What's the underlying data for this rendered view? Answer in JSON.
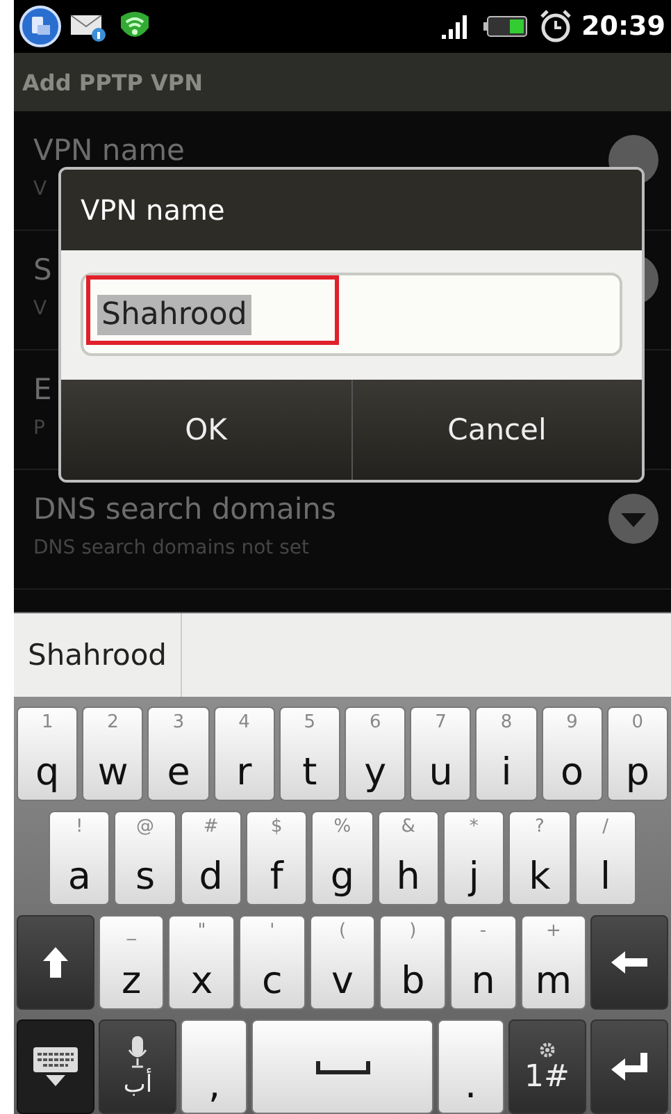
{
  "status_bar": {
    "time": "20:39"
  },
  "title_bar": {
    "title": "Add PPTP VPN"
  },
  "settings": [
    {
      "title": "VPN name",
      "summary": "V",
      "kind": "circle"
    },
    {
      "title": "S",
      "summary": "V",
      "kind": "circle"
    },
    {
      "title": "E",
      "summary": "P",
      "kind": "none"
    },
    {
      "title": "DNS search domains",
      "summary": "DNS search domains not set",
      "kind": "dropdown"
    }
  ],
  "dialog": {
    "title": "VPN name",
    "field": {
      "value": "Shahrood",
      "text_selected": true,
      "annotated": true
    },
    "buttons": [
      "OK",
      "Cancel"
    ]
  },
  "suggestions": [
    "Shahrood"
  ],
  "keyboard": {
    "rows": [
      {
        "keys": [
          {
            "kind": "letter",
            "label": "q",
            "hint": "1"
          },
          {
            "kind": "letter",
            "label": "w",
            "hint": "2"
          },
          {
            "kind": "letter",
            "label": "e",
            "hint": "3"
          },
          {
            "kind": "letter",
            "label": "r",
            "hint": "4"
          },
          {
            "kind": "letter",
            "label": "t",
            "hint": "5"
          },
          {
            "kind": "letter",
            "label": "y",
            "hint": "6"
          },
          {
            "kind": "letter",
            "label": "u",
            "hint": "7"
          },
          {
            "kind": "letter",
            "label": "i",
            "hint": "8"
          },
          {
            "kind": "letter",
            "label": "o",
            "hint": "9"
          },
          {
            "kind": "letter",
            "label": "p",
            "hint": "0"
          }
        ]
      },
      {
        "keys": [
          {
            "kind": "letter",
            "label": "a",
            "hint": "!"
          },
          {
            "kind": "letter",
            "label": "s",
            "hint": "@"
          },
          {
            "kind": "letter",
            "label": "d",
            "hint": "#"
          },
          {
            "kind": "letter",
            "label": "f",
            "hint": "$"
          },
          {
            "kind": "letter",
            "label": "g",
            "hint": "%"
          },
          {
            "kind": "letter",
            "label": "h",
            "hint": "&"
          },
          {
            "kind": "letter",
            "label": "j",
            "hint": "*"
          },
          {
            "kind": "letter",
            "label": "k",
            "hint": "?"
          },
          {
            "kind": "letter",
            "label": "l",
            "hint": "/"
          }
        ]
      },
      {
        "keys": [
          {
            "kind": "shift"
          },
          {
            "kind": "letter",
            "label": "z",
            "hint": "_"
          },
          {
            "kind": "letter",
            "label": "x",
            "hint": "\""
          },
          {
            "kind": "letter",
            "label": "c",
            "hint": "'"
          },
          {
            "kind": "letter",
            "label": "v",
            "hint": "("
          },
          {
            "kind": "letter",
            "label": "b",
            "hint": ")"
          },
          {
            "kind": "letter",
            "label": "n",
            "hint": "-"
          },
          {
            "kind": "letter",
            "label": "m",
            "hint": "+"
          },
          {
            "kind": "backspace"
          }
        ]
      },
      {
        "keys": [
          {
            "kind": "ime"
          },
          {
            "kind": "mic",
            "label": "أب"
          },
          {
            "kind": "letter",
            "label": ","
          },
          {
            "kind": "space"
          },
          {
            "kind": "letter",
            "label": "."
          },
          {
            "kind": "symbols",
            "label": "1#"
          },
          {
            "kind": "enter"
          }
        ]
      }
    ]
  }
}
